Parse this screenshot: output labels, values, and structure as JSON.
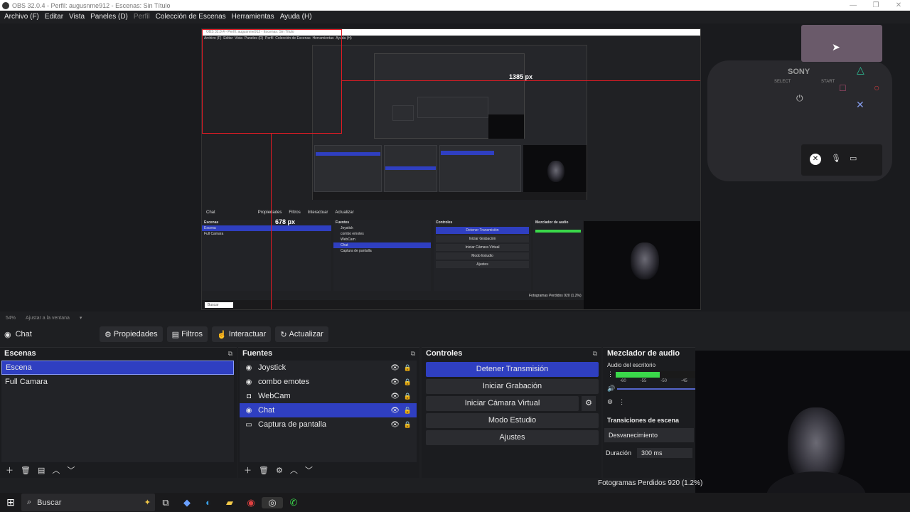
{
  "window": {
    "title": "OBS 32.0.4 - Perfil: augusnme912 - Escenas: Sin Título",
    "controls": [
      "—",
      "❐",
      "✕"
    ]
  },
  "menu": [
    {
      "label": "Archivo (F)",
      "disabled": false
    },
    {
      "label": "Editar",
      "disabled": false
    },
    {
      "label": "Vista",
      "disabled": false
    },
    {
      "label": "Paneles (D)",
      "disabled": false
    },
    {
      "label": "Perfil",
      "disabled": true
    },
    {
      "label": "Colección de Escenas",
      "disabled": false
    },
    {
      "label": "Herramientas",
      "disabled": false
    },
    {
      "label": "Ayuda (H)",
      "disabled": false
    }
  ],
  "preview": {
    "measure_h": "1385 px",
    "measure_v": "678 px",
    "nested_source": "Chat",
    "nested_buttons": [
      "Propiedades",
      "Filtros",
      "Interactuar",
      "Actualizar"
    ],
    "nested_scenes": [
      "Escena",
      "Full Camara"
    ],
    "nested_sources": [
      "Joystick",
      "combo emotes",
      "WebCam",
      "Chat",
      "Captura de pantalla"
    ],
    "nested_controls": [
      "Detener Transmisión",
      "Iniciar Grabación",
      "Iniciar Cámara Virtual",
      "Modo Estudio",
      "Ajustes"
    ],
    "nested_headers": [
      "Escenas",
      "Fuentes",
      "Controles",
      "Mezclador de audio"
    ],
    "nested_status": "Fotogramas Perdidos 920 (1.2%)",
    "controller_brand": "SONY",
    "controller_select": "SELECT",
    "controller_start": "START",
    "nested_zoom": "54%",
    "nested_fit": "Ajustar a la ventana",
    "nested_search": "Buscar"
  },
  "zoom": {
    "value": "54%",
    "fit_label": "Ajustar a la ventana"
  },
  "toolbar": {
    "source": "Chat",
    "buttons": [
      {
        "label": "Propiedades",
        "icon": "gear-icon"
      },
      {
        "label": "Filtros",
        "icon": "filter-icon"
      },
      {
        "label": "Interactuar",
        "icon": "hand-icon"
      },
      {
        "label": "Actualizar",
        "icon": "refresh-icon"
      }
    ]
  },
  "scenes": {
    "title": "Escenas",
    "items": [
      "Escena",
      "Full Camara"
    ],
    "selected": 0
  },
  "sources": {
    "title": "Fuentes",
    "items": [
      {
        "label": "Joystick",
        "icon": "globe-icon"
      },
      {
        "label": "combo emotes",
        "icon": "globe-icon"
      },
      {
        "label": "WebCam",
        "icon": "camera-icon"
      },
      {
        "label": "Chat",
        "icon": "globe-icon"
      },
      {
        "label": "Captura de pantalla",
        "icon": "monitor-icon"
      }
    ],
    "selected": 3
  },
  "controls": {
    "title": "Controles",
    "buttons": [
      "Detener Transmisión",
      "Iniciar Grabación",
      "Iniciar Cámara Virtual",
      "Modo Estudio",
      "Ajustes"
    ]
  },
  "mixer": {
    "title": "Mezclador de audio",
    "track": "Audio del escritorio",
    "ticks": [
      "-60",
      "-55",
      "-50",
      "-45"
    ],
    "level": 0.55,
    "transitions_title": "Transiciones de escena",
    "transition": "Desvanecimiento",
    "duration_label": "Duración",
    "duration_value": "300 ms"
  },
  "status": {
    "dropped": "Fotogramas Perdidos 920 (1.2%)"
  },
  "taskbar": {
    "search": "Buscar"
  },
  "colors": {
    "accent": "#2f3fc1",
    "measure": "#e01b24",
    "meter": "#3ad84a"
  }
}
